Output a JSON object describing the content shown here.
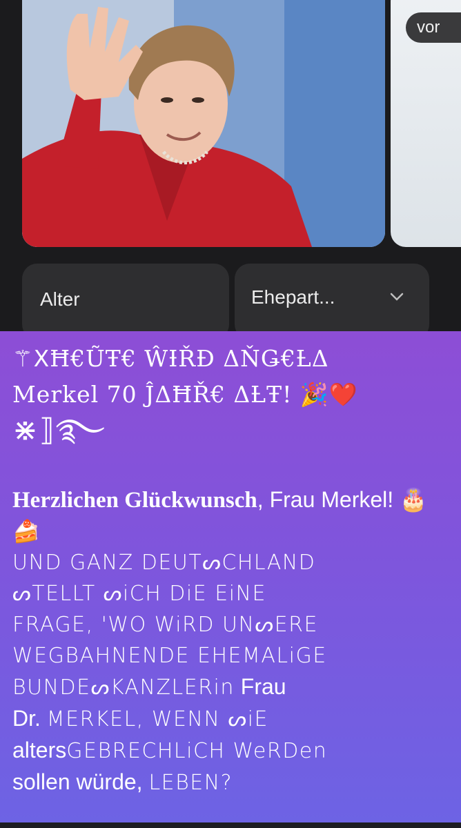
{
  "gallery": {
    "more_label": "vor",
    "photo_alt": "person-waving-photo"
  },
  "chips": {
    "alter": "Alter",
    "ehepartner": "Ehepart..."
  },
  "post": {
    "headline_prefix_symbol": "⚚",
    "headline_line1": "ꓫĦ€ŨŦ€ ŴƗŘĐ  ΔŇǤ€ȽΔ",
    "headline_line2a": "Merkel",
    "headline_line2b": " 70 ĴΔĦŘ€ ΔȽŦ! 🎉❤️",
    "headline_ornament": "⋇⟧࿐",
    "greeting_bold": "Herzlichen Glückwunsch",
    "greeting_rest": ", Frau Merkel! 🎂🍰",
    "line_1": "UND GANZ DEUTᔕCHLAND",
    "line_2": "ᔕTELLT ᔕiCH DiE EiNE",
    "line_3": "FRAGE, 'WO WiRD  UNᔕERE",
    "line_4": "WEGBAHNENDE EHEMALiGE",
    "line_5a": "BUNDEᔕKANZLERin",
    "line_5b": " Frau",
    "line_6a": "Dr. ",
    "line_6b": "MERKEL, WENN ᔕiE",
    "line_7a": "alters",
    "line_7b": "GEBRECHLiCH WeRDen",
    "line_8a": "sollen würde, ",
    "line_8b": "LEBEN?"
  }
}
